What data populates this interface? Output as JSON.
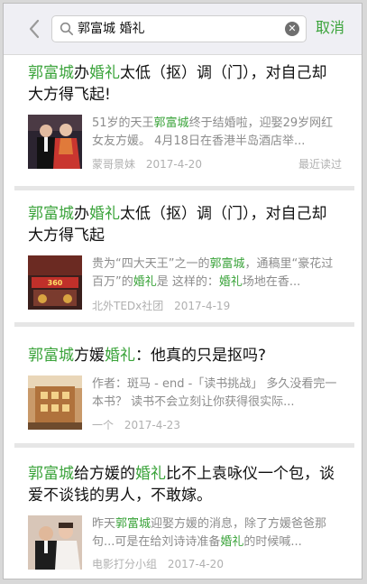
{
  "search": {
    "query": "郭富城 婚礼",
    "cancel_label": "取消"
  },
  "results": [
    {
      "title": [
        {
          "t": "郭富城",
          "hl": true
        },
        {
          "t": "办",
          "hl": false
        },
        {
          "t": "婚礼",
          "hl": true
        },
        {
          "t": "太低（抠）调（门），对自己却大方得飞起!",
          "hl": false
        }
      ],
      "snippet": [
        {
          "t": "51岁的天王",
          "hl": false
        },
        {
          "t": "郭富城",
          "hl": true
        },
        {
          "t": "终于结婚啦，迎娶29岁网红女友方媛。 4月18日在香港半岛酒店举...",
          "hl": false
        }
      ],
      "source": "蒙哥景妹",
      "date": "2017-4-20",
      "recent": "最近读过"
    },
    {
      "title": [
        {
          "t": "郭富城",
          "hl": true
        },
        {
          "t": "办",
          "hl": false
        },
        {
          "t": "婚礼",
          "hl": true
        },
        {
          "t": "太低（抠）调（门），对自己却大方得飞起",
          "hl": false
        }
      ],
      "snippet": [
        {
          "t": "贵为“四大天王”之一的",
          "hl": false
        },
        {
          "t": "郭富城",
          "hl": true
        },
        {
          "t": "，通稿里“豪花过百万”的",
          "hl": false
        },
        {
          "t": "婚礼",
          "hl": true
        },
        {
          "t": "是 这样的：",
          "hl": false
        },
        {
          "t": "婚礼",
          "hl": true
        },
        {
          "t": "场地在香...",
          "hl": false
        }
      ],
      "source": "北外TEDx社团",
      "date": "2017-4-19",
      "recent": ""
    },
    {
      "title": [
        {
          "t": "郭富城",
          "hl": true
        },
        {
          "t": "方媛",
          "hl": false
        },
        {
          "t": "婚礼",
          "hl": true
        },
        {
          "t": "：他真的只是抠吗?",
          "hl": false
        }
      ],
      "snippet": [
        {
          "t": "作者：斑马 - end -「读书挑战」 多久没看完一本书？ 读书不会立刻让你获得很实际...",
          "hl": false
        }
      ],
      "source": "一个",
      "date": "2017-4-23",
      "recent": ""
    },
    {
      "title": [
        {
          "t": "郭富城",
          "hl": true
        },
        {
          "t": "给方媛的",
          "hl": false
        },
        {
          "t": "婚礼",
          "hl": true
        },
        {
          "t": "比不上袁咏仪一个包，谈爱不谈钱的男人，不敢嫁。",
          "hl": false
        }
      ],
      "snippet": [
        {
          "t": "昨天",
          "hl": false
        },
        {
          "t": "郭富城",
          "hl": true
        },
        {
          "t": "迎娶方媛的消息，除了方媛爸爸那句...可是在给刘诗诗准备",
          "hl": false
        },
        {
          "t": "婚礼",
          "hl": true
        },
        {
          "t": "的时候喊...",
          "hl": false
        }
      ],
      "source": "电影打分小组",
      "date": "2017-4-20",
      "recent": ""
    }
  ],
  "colors": {
    "accent": "#3aa33a",
    "meta": "#b0b0b0",
    "snippet": "#8c8c8c"
  }
}
